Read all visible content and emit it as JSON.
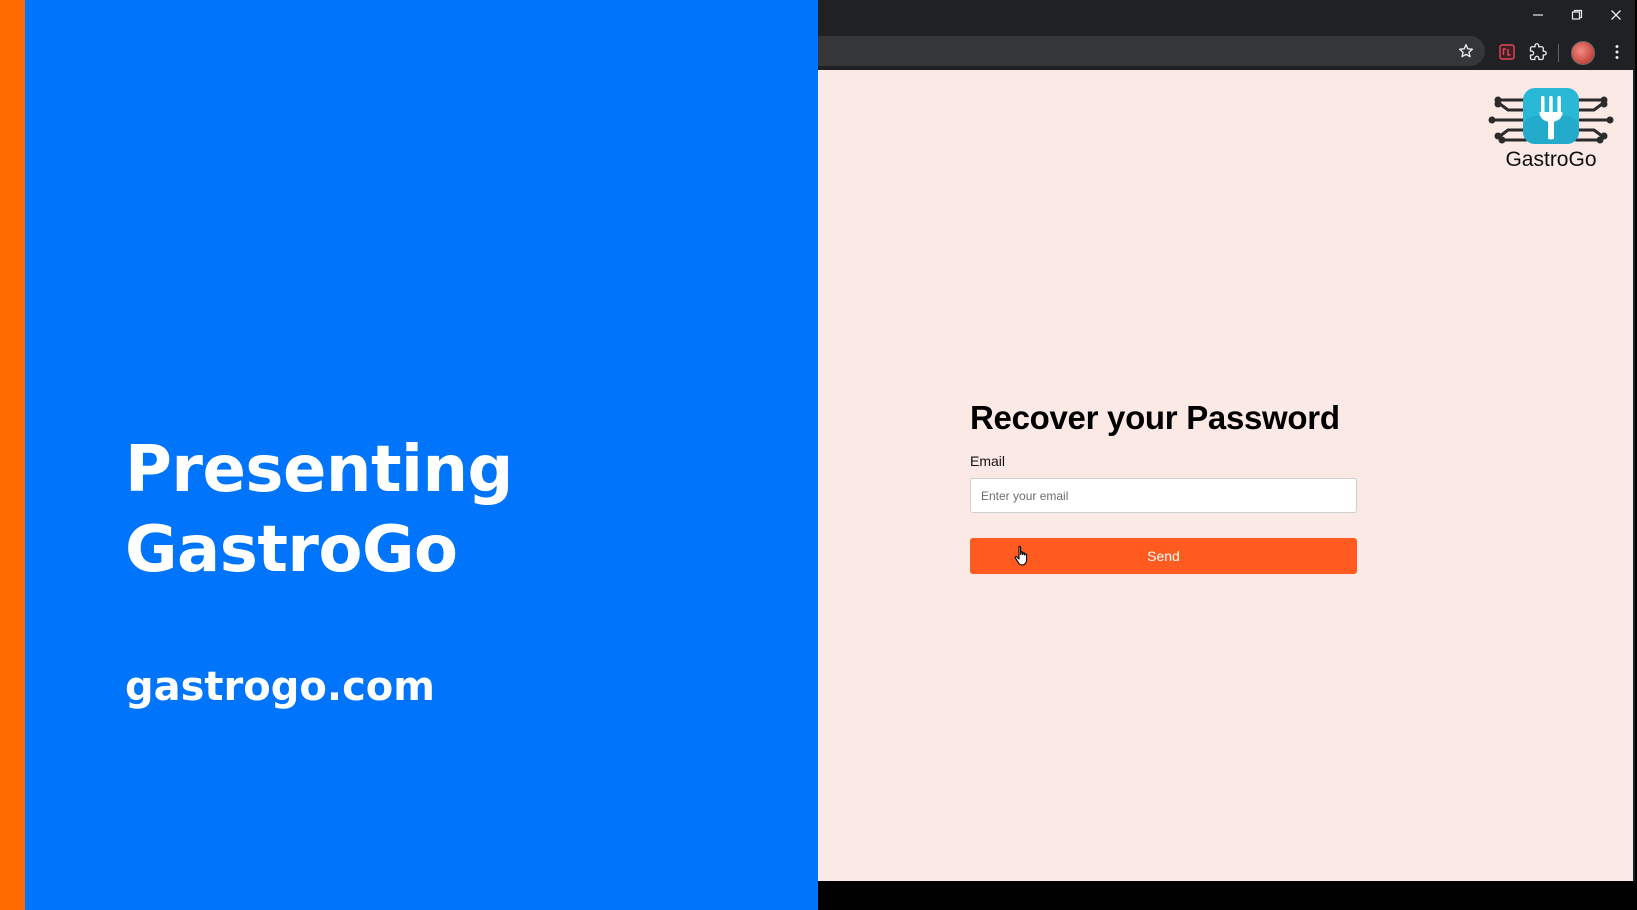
{
  "slide": {
    "title_line1": "Presenting",
    "title_line2": "GastroGo",
    "url": "gastrogo.com",
    "background_color": "#0074fa",
    "stripe_color": "#ff6a00"
  },
  "browser": {
    "window_controls": [
      "minimize-icon",
      "restore-icon",
      "close-icon"
    ],
    "toolbar_icons": [
      "star-icon",
      "extension-badge-icon",
      "puzzle-icon",
      "avatar",
      "more-vert-icon"
    ]
  },
  "page": {
    "background_color": "#fbe9e6",
    "logo": {
      "name": "GastroGo",
      "icon": "fork-circuit-icon",
      "icon_color": "#29b8d6"
    },
    "form": {
      "title": "Recover your Password",
      "email_label": "Email",
      "email_placeholder": "Enter your email",
      "email_value": "",
      "send_label": "Send",
      "button_color": "#ff5a1f"
    }
  }
}
